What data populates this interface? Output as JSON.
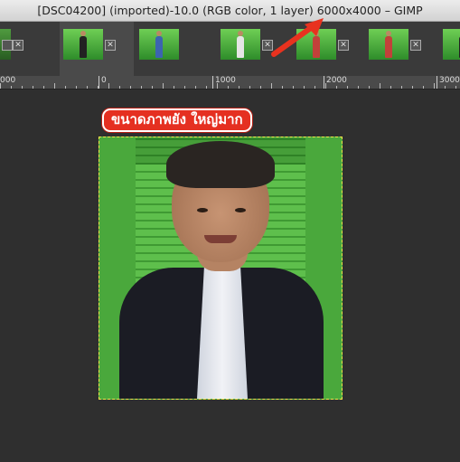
{
  "window": {
    "title": "[DSC04200] (imported)-10.0 (RGB color, 1 layer) 6000x4000 – GIMP"
  },
  "image_tabs": [
    {
      "name": "tab-image-1",
      "close_glyph": "✕"
    },
    {
      "name": "tab-image-2",
      "close_glyph": "✕"
    },
    {
      "name": "tab-image-3",
      "close_glyph": "✕"
    },
    {
      "name": "tab-image-4",
      "close_glyph": "✕"
    },
    {
      "name": "tab-image-5",
      "close_glyph": "✕"
    },
    {
      "name": "tab-image-6",
      "close_glyph": "✕"
    }
  ],
  "ruler": {
    "labels": [
      "000",
      "0",
      "1000",
      "2000",
      "3000"
    ]
  },
  "callout": {
    "text": "ขนาดภาพยัง ใหญ่มาก",
    "color": "#e53021"
  },
  "annotation_arrow": {
    "color": "#e8321f"
  }
}
